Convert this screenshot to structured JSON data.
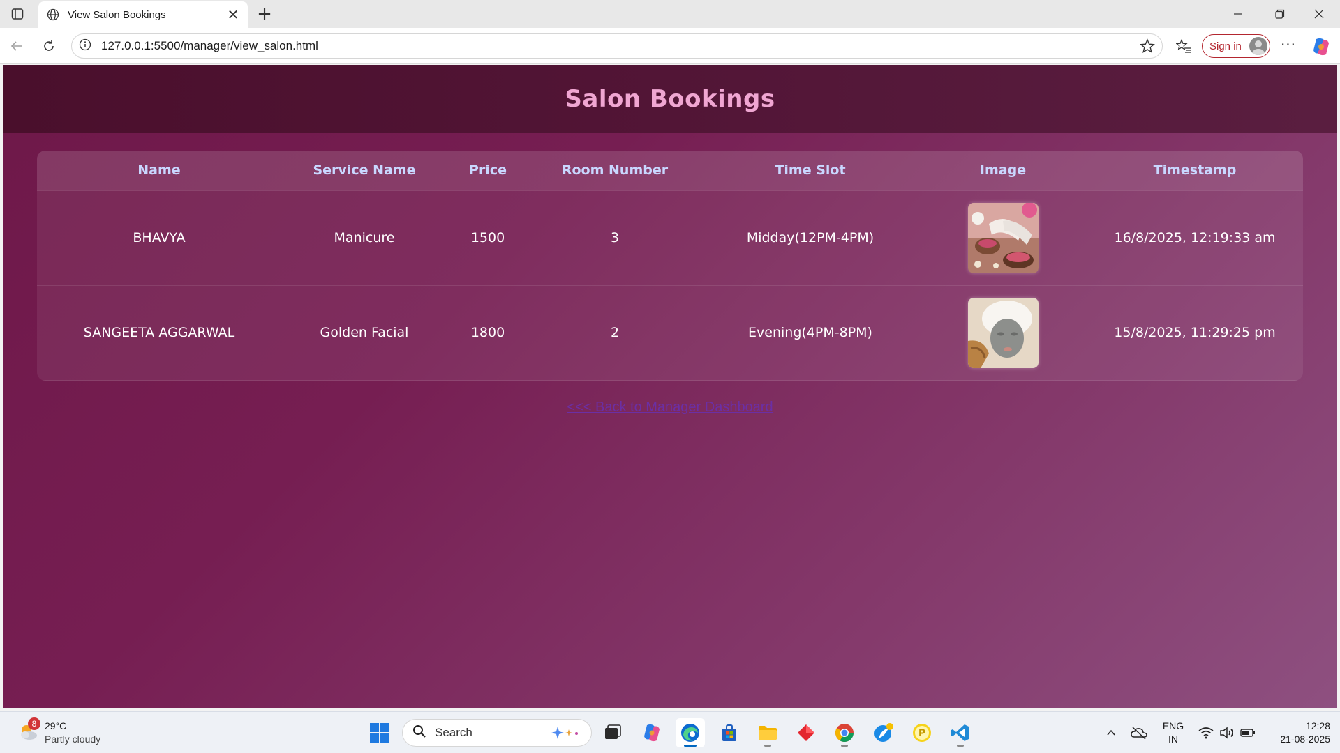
{
  "browser": {
    "tab_title": "View Salon Bookings",
    "url": "127.0.0.1:5500/manager/view_salon.html",
    "signin_label": "Sign in"
  },
  "page": {
    "title": "Salon Bookings",
    "back_link": "<<< Back to Manager Dashboard"
  },
  "table": {
    "headers": [
      "Name",
      "Service Name",
      "Price",
      "Room Number",
      "Time Slot",
      "Image",
      "Timestamp"
    ],
    "rows": [
      {
        "name": "BHAVYA",
        "service": "Manicure",
        "price": "1500",
        "room": "3",
        "slot": "Midday(12PM-4PM)",
        "image_icon": "manicure-photo",
        "timestamp": "16/8/2025, 12:19:33 am"
      },
      {
        "name": "SANGEETA AGGARWAL",
        "service": "Golden Facial",
        "price": "1800",
        "room": "2",
        "slot": "Evening(4PM-8PM)",
        "image_icon": "facial-photo",
        "timestamp": "15/8/2025, 11:29:25 pm"
      }
    ]
  },
  "taskbar": {
    "weather_badge": "8",
    "weather_temp": "29°C",
    "weather_desc": "Partly cloudy",
    "search_label": "Search",
    "lang_line1": "ENG",
    "lang_line2": "IN",
    "time": "12:28",
    "date": "21-08-2025"
  },
  "colors": {
    "header_title": "#f0a6d2",
    "table_header_text": "#c9d7ff",
    "link": "#6b2fa5",
    "signin_accent": "#b3262f"
  }
}
